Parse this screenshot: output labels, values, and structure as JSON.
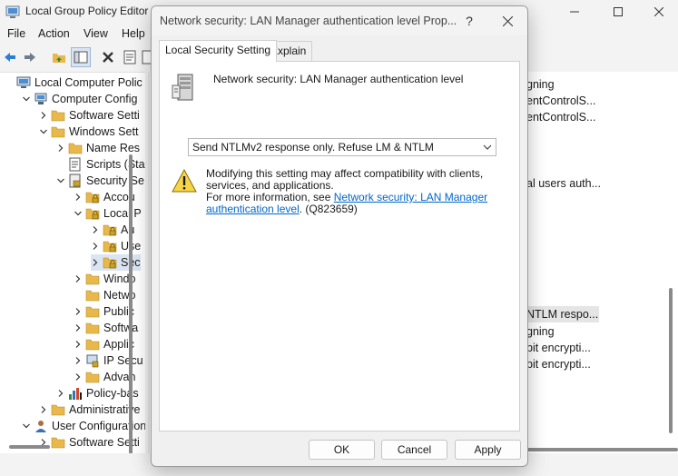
{
  "app": {
    "title": "Local Group Policy Editor"
  },
  "menu": [
    "File",
    "Action",
    "View",
    "Help"
  ],
  "tree": [
    {
      "label": "Local Computer Polic",
      "indent": 0,
      "chev": "none",
      "icon": "computer-icon"
    },
    {
      "label": "Computer Config",
      "indent": 1,
      "chev": "down",
      "icon": "computer-config-icon"
    },
    {
      "label": "Software Setti",
      "indent": 2,
      "chev": "right",
      "icon": "folder-icon"
    },
    {
      "label": "Windows Sett",
      "indent": 2,
      "chev": "down",
      "icon": "folder-icon"
    },
    {
      "label": "Name Res",
      "indent": 3,
      "chev": "right",
      "icon": "folder-icon"
    },
    {
      "label": "Scripts (Sta",
      "indent": 3,
      "chev": "none",
      "icon": "scripts-icon"
    },
    {
      "label": "Security Se",
      "indent": 3,
      "chev": "down",
      "icon": "security-settings-icon"
    },
    {
      "label": "Accou",
      "indent": 4,
      "chev": "right",
      "icon": "locked-folder-icon"
    },
    {
      "label": "Local P",
      "indent": 4,
      "chev": "down",
      "icon": "locked-folder-icon"
    },
    {
      "label": "Au",
      "indent": 5,
      "chev": "right",
      "icon": "locked-folder-icon"
    },
    {
      "label": "Use",
      "indent": 5,
      "chev": "right",
      "icon": "locked-folder-icon"
    },
    {
      "label": "Sec",
      "indent": 5,
      "chev": "right",
      "icon": "locked-folder-icon",
      "selected": true
    },
    {
      "label": "Windo",
      "indent": 4,
      "chev": "right",
      "icon": "folder-icon"
    },
    {
      "label": "Netwo",
      "indent": 4,
      "chev": "none",
      "icon": "folder-icon"
    },
    {
      "label": "Public",
      "indent": 4,
      "chev": "right",
      "icon": "folder-icon"
    },
    {
      "label": "Softwa",
      "indent": 4,
      "chev": "right",
      "icon": "folder-icon"
    },
    {
      "label": "Applic",
      "indent": 4,
      "chev": "right",
      "icon": "folder-icon"
    },
    {
      "label": "IP Secu",
      "indent": 4,
      "chev": "right",
      "icon": "ip-security-icon"
    },
    {
      "label": "Advan",
      "indent": 4,
      "chev": "right",
      "icon": "folder-icon"
    },
    {
      "label": "Policy-bas",
      "indent": 3,
      "chev": "right",
      "icon": "chart-icon"
    },
    {
      "label": "Administrative",
      "indent": 2,
      "chev": "right",
      "icon": "folder-icon"
    },
    {
      "label": "User Configuration",
      "indent": 1,
      "chev": "down",
      "icon": "user-config-icon"
    },
    {
      "label": "Software Setti",
      "indent": 2,
      "chev": "right",
      "icon": "folder-icon"
    }
  ],
  "right_items": [
    {
      "text": "gning",
      "row": 0
    },
    {
      "text": "entControlS...",
      "row": 1
    },
    {
      "text": "entControlS...",
      "row": 2
    },
    {
      "text": "al users auth...",
      "row": 6
    },
    {
      "text": "NTLM respo...",
      "row": 14,
      "selected": true
    },
    {
      "text": "gning",
      "row": 15
    },
    {
      "text": "bit encrypti...",
      "row": 16
    },
    {
      "text": "bit encrypti...",
      "row": 17
    }
  ],
  "dialog": {
    "title": "Network security: LAN Manager authentication level Prop...",
    "help_glyph": "?",
    "tabs": [
      "Local Security Setting",
      "Explain"
    ],
    "policy_name": "Network security: LAN Manager authentication level",
    "selected_value": "Send NTLMv2 response only. Refuse LM & NTLM",
    "warning_line1": "Modifying this setting may affect compatibility with clients, services, and applications.",
    "warning_prefix": "For more information, see ",
    "warning_link": "Network security: LAN Manager authentication level",
    "warning_suffix": ". (Q823659)",
    "ok": "OK",
    "cancel": "Cancel",
    "apply": "Apply"
  },
  "colors": {
    "link": "#0066cc",
    "selection": "#dbe5f1",
    "folder": "#e8b84a"
  }
}
